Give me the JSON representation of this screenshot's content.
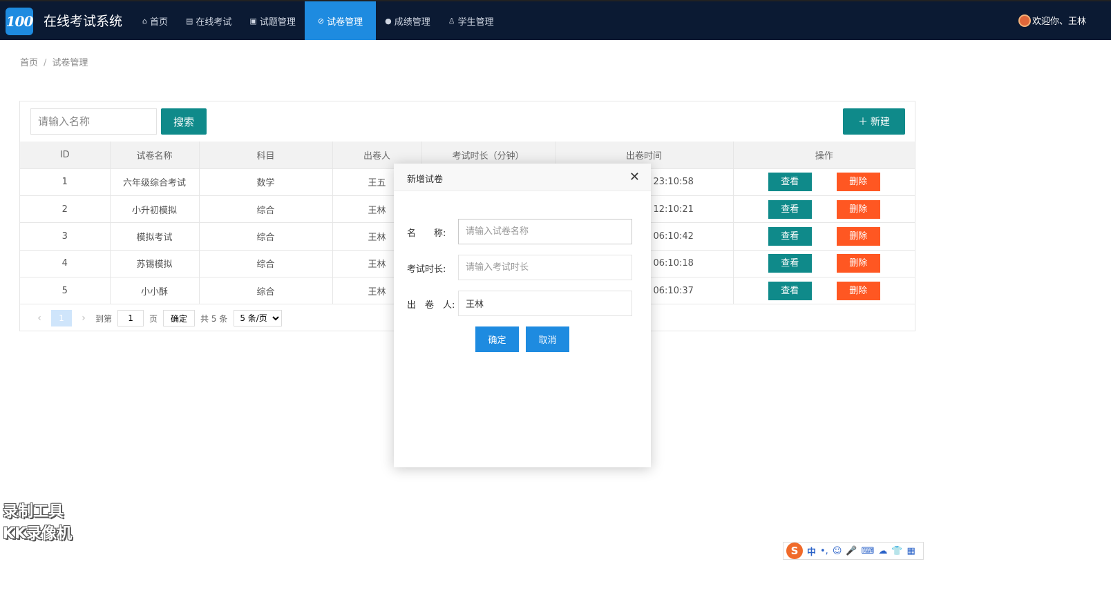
{
  "app": {
    "logo_text": "100",
    "title": "在线考试系统"
  },
  "nav": [
    {
      "icon": "⌂",
      "label": "首页"
    },
    {
      "icon": "▤",
      "label": "在线考试"
    },
    {
      "icon": "▣",
      "label": "试题管理"
    },
    {
      "icon": "⊘",
      "label": "试卷管理"
    },
    {
      "icon": "●",
      "label": "成绩管理"
    },
    {
      "icon": "♙",
      "label": "学生管理"
    }
  ],
  "user": {
    "greeting": "欢迎你、王林"
  },
  "breadcrumb": {
    "home": "首页",
    "current": "试卷管理"
  },
  "toolbar": {
    "search_placeholder": "请输入名称",
    "search_label": "搜索",
    "new_label": "＋ 新建"
  },
  "table": {
    "headers": [
      "ID",
      "试卷名称",
      "科目",
      "出卷人",
      "考试时长（分钟）",
      "出卷时间",
      "操作"
    ],
    "view_label": "查看",
    "delete_label": "删除",
    "rows": [
      {
        "id": "1",
        "name": "六年级综合考试",
        "subject": "数学",
        "author": "王五",
        "duration": "",
        "time": "23:10:58"
      },
      {
        "id": "2",
        "name": "小升初模拟",
        "subject": "综合",
        "author": "王林",
        "duration": "",
        "time": "12:10:21"
      },
      {
        "id": "3",
        "name": "模拟考试",
        "subject": "综合",
        "author": "王林",
        "duration": "",
        "time": "06:10:42"
      },
      {
        "id": "4",
        "name": "苏锡模拟",
        "subject": "综合",
        "author": "王林",
        "duration": "",
        "time": "06:10:18"
      },
      {
        "id": "5",
        "name": "小小酥",
        "subject": "综合",
        "author": "王林",
        "duration": "",
        "time": "06:10:37"
      }
    ]
  },
  "pager": {
    "prev": "‹",
    "next": "›",
    "current": "1",
    "goto_label": "到第",
    "goto_value": "1",
    "page_label": "页",
    "ok_label": "确定",
    "total": "共 5 条",
    "per_page": "5 条/页"
  },
  "modal": {
    "title": "新增试卷",
    "close": "✕",
    "name_label": "名　　称:",
    "name_placeholder": "请输入试卷名称",
    "duration_label": "考试时长:",
    "duration_placeholder": "请输入考试时长",
    "author_label": "出　卷　人:",
    "author_value": "王林",
    "confirm_label": "确定",
    "cancel_label": "取消"
  },
  "watermark": {
    "line1": "录制工具",
    "line2": "KK录像机"
  },
  "ime": {
    "logo": "S",
    "items": [
      "中",
      "•,",
      "☺",
      "🎤",
      "⌨",
      "☁",
      "👕",
      "▦"
    ]
  },
  "colors": {
    "nav_bg": "#0b1a33",
    "accent": "#1e8be0",
    "teal": "#0f8a8a",
    "danger": "#ff5722"
  }
}
